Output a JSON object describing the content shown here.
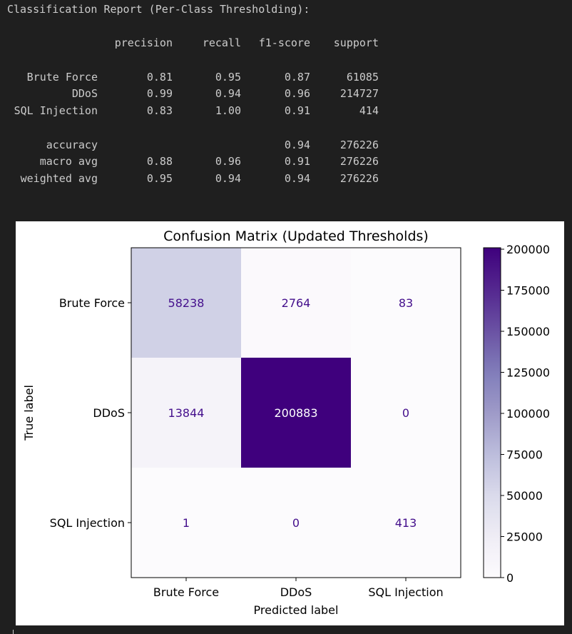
{
  "report": {
    "title": "Classification Report (Per-Class Thresholding):",
    "headers": [
      "precision",
      "recall",
      "f1-score",
      "support"
    ],
    "rows": [
      {
        "label": "Brute Force",
        "precision": "0.81",
        "recall": "0.95",
        "f1": "0.87",
        "support": "61085"
      },
      {
        "label": "DDoS",
        "precision": "0.99",
        "recall": "0.94",
        "f1": "0.96",
        "support": "214727"
      },
      {
        "label": "SQL Injection",
        "precision": "0.83",
        "recall": "1.00",
        "f1": "0.91",
        "support": "414"
      }
    ],
    "summary": [
      {
        "label": "accuracy",
        "precision": "",
        "recall": "",
        "f1": "0.94",
        "support": "276226"
      },
      {
        "label": "macro avg",
        "precision": "0.88",
        "recall": "0.96",
        "f1": "0.91",
        "support": "276226"
      },
      {
        "label": "weighted avg",
        "precision": "0.95",
        "recall": "0.94",
        "f1": "0.94",
        "support": "276226"
      }
    ]
  },
  "chart_data": {
    "type": "heatmap",
    "title": "Confusion Matrix (Updated Thresholds)",
    "xlabel": "Predicted label",
    "ylabel": "True label",
    "x_categories": [
      "Brute Force",
      "DDoS",
      "SQL Injection"
    ],
    "y_categories": [
      "Brute Force",
      "DDoS",
      "SQL Injection"
    ],
    "values": [
      [
        58238,
        2764,
        83
      ],
      [
        13844,
        200883,
        0
      ],
      [
        1,
        0,
        413
      ]
    ],
    "colorbar": {
      "min": 0,
      "max": 200883,
      "ticks": [
        0,
        25000,
        50000,
        75000,
        100000,
        125000,
        150000,
        175000,
        200000
      ],
      "colormap": "Purples"
    },
    "colors": {
      "text_on_light": "#440f8c",
      "text_on_dark": "#ffffff",
      "axis": "#000000"
    }
  }
}
